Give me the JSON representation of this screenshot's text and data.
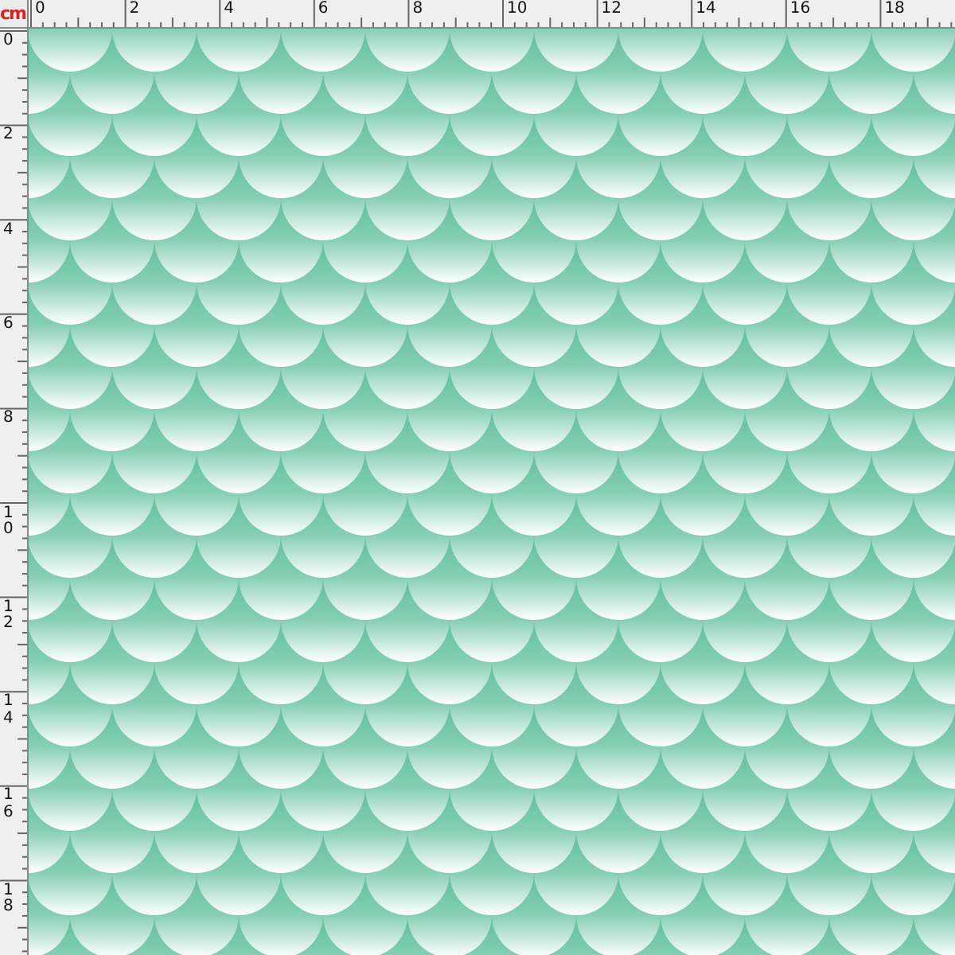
{
  "ruler_unit": "cm",
  "horizontal_ruler": {
    "labels": [
      "0",
      "2",
      "4",
      "6",
      "8",
      "10",
      "12",
      "14",
      "16",
      "18"
    ]
  },
  "vertical_ruler": {
    "labels": [
      "0",
      "2",
      "4",
      "6",
      "8",
      "10",
      "12",
      "14",
      "16",
      "18"
    ]
  }
}
